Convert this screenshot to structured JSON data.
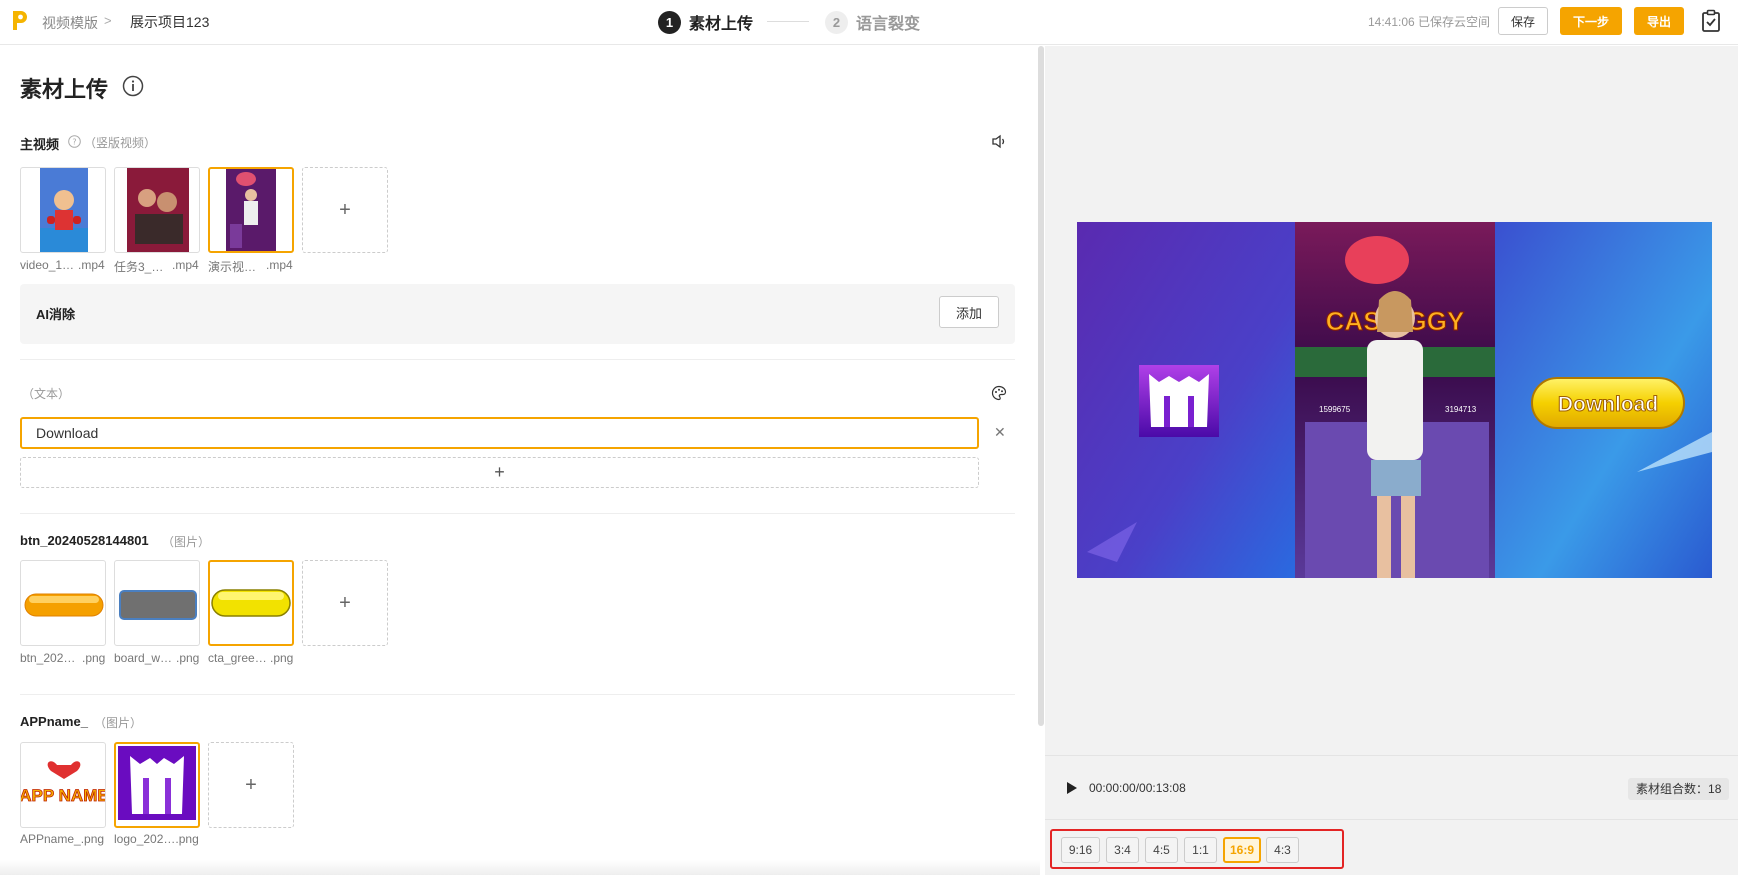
{
  "header": {
    "breadcrumb_root": "视频模版",
    "breadcrumb_sep": ">",
    "project_name": "展示项目123",
    "steps": [
      {
        "num": "1",
        "label": "素材上传",
        "active": true
      },
      {
        "num": "2",
        "label": "语言裂变",
        "active": false
      }
    ],
    "save_status": "14:41:06 已保存云空间",
    "save_label": "保存",
    "next_label": "下一步",
    "export_label": "导出",
    "accent_color": "#f5a400"
  },
  "page_title": "素材上传",
  "main_video": {
    "title": "主视频",
    "hint": "（竖版视频）",
    "files": [
      {
        "name_start": "video_1…",
        "ext": ".mp4",
        "selected": false
      },
      {
        "name_start": "任务3_…",
        "ext": ".mp4",
        "selected": false
      },
      {
        "name_start": "演示视…",
        "ext": ".mp4",
        "selected": true
      }
    ],
    "add_symbol": "+"
  },
  "ai_removal": {
    "label": "AI消除",
    "add_label": "添加"
  },
  "text_section": {
    "hint": "（文本）",
    "value": "Download",
    "add_symbol": "+",
    "clear_symbol": "✕"
  },
  "btn_section": {
    "title": "btn_20240528144801",
    "hint": "（图片）",
    "files": [
      {
        "name_start": "btn_202…",
        "ext": ".png",
        "selected": false
      },
      {
        "name_start": "board_w…",
        "ext": ".png",
        "selected": false
      },
      {
        "name_start": "cta_gree…",
        "ext": ".png",
        "selected": true
      }
    ],
    "add_symbol": "+"
  },
  "appname_section": {
    "title": "APPname_",
    "hint": "（图片）",
    "files": [
      {
        "name": "APPname_.png",
        "selected": false,
        "art_text": "APP NAME"
      },
      {
        "name": "logo_202….png",
        "selected": true
      }
    ],
    "add_symbol": "+"
  },
  "preview": {
    "cta_text": "Download",
    "game_banner_text": "CASH  GGY",
    "score_left": "1599675",
    "score_right": "3194713"
  },
  "player": {
    "time": "00:00:00/00:13:08",
    "combo_label": "素材组合数：",
    "combo_count": "18"
  },
  "ratios": [
    {
      "label": "9:16",
      "active": false
    },
    {
      "label": "3:4",
      "active": false
    },
    {
      "label": "4:5",
      "active": false
    },
    {
      "label": "1:1",
      "active": false
    },
    {
      "label": "16:9",
      "active": true
    },
    {
      "label": "4:3",
      "active": false
    }
  ]
}
